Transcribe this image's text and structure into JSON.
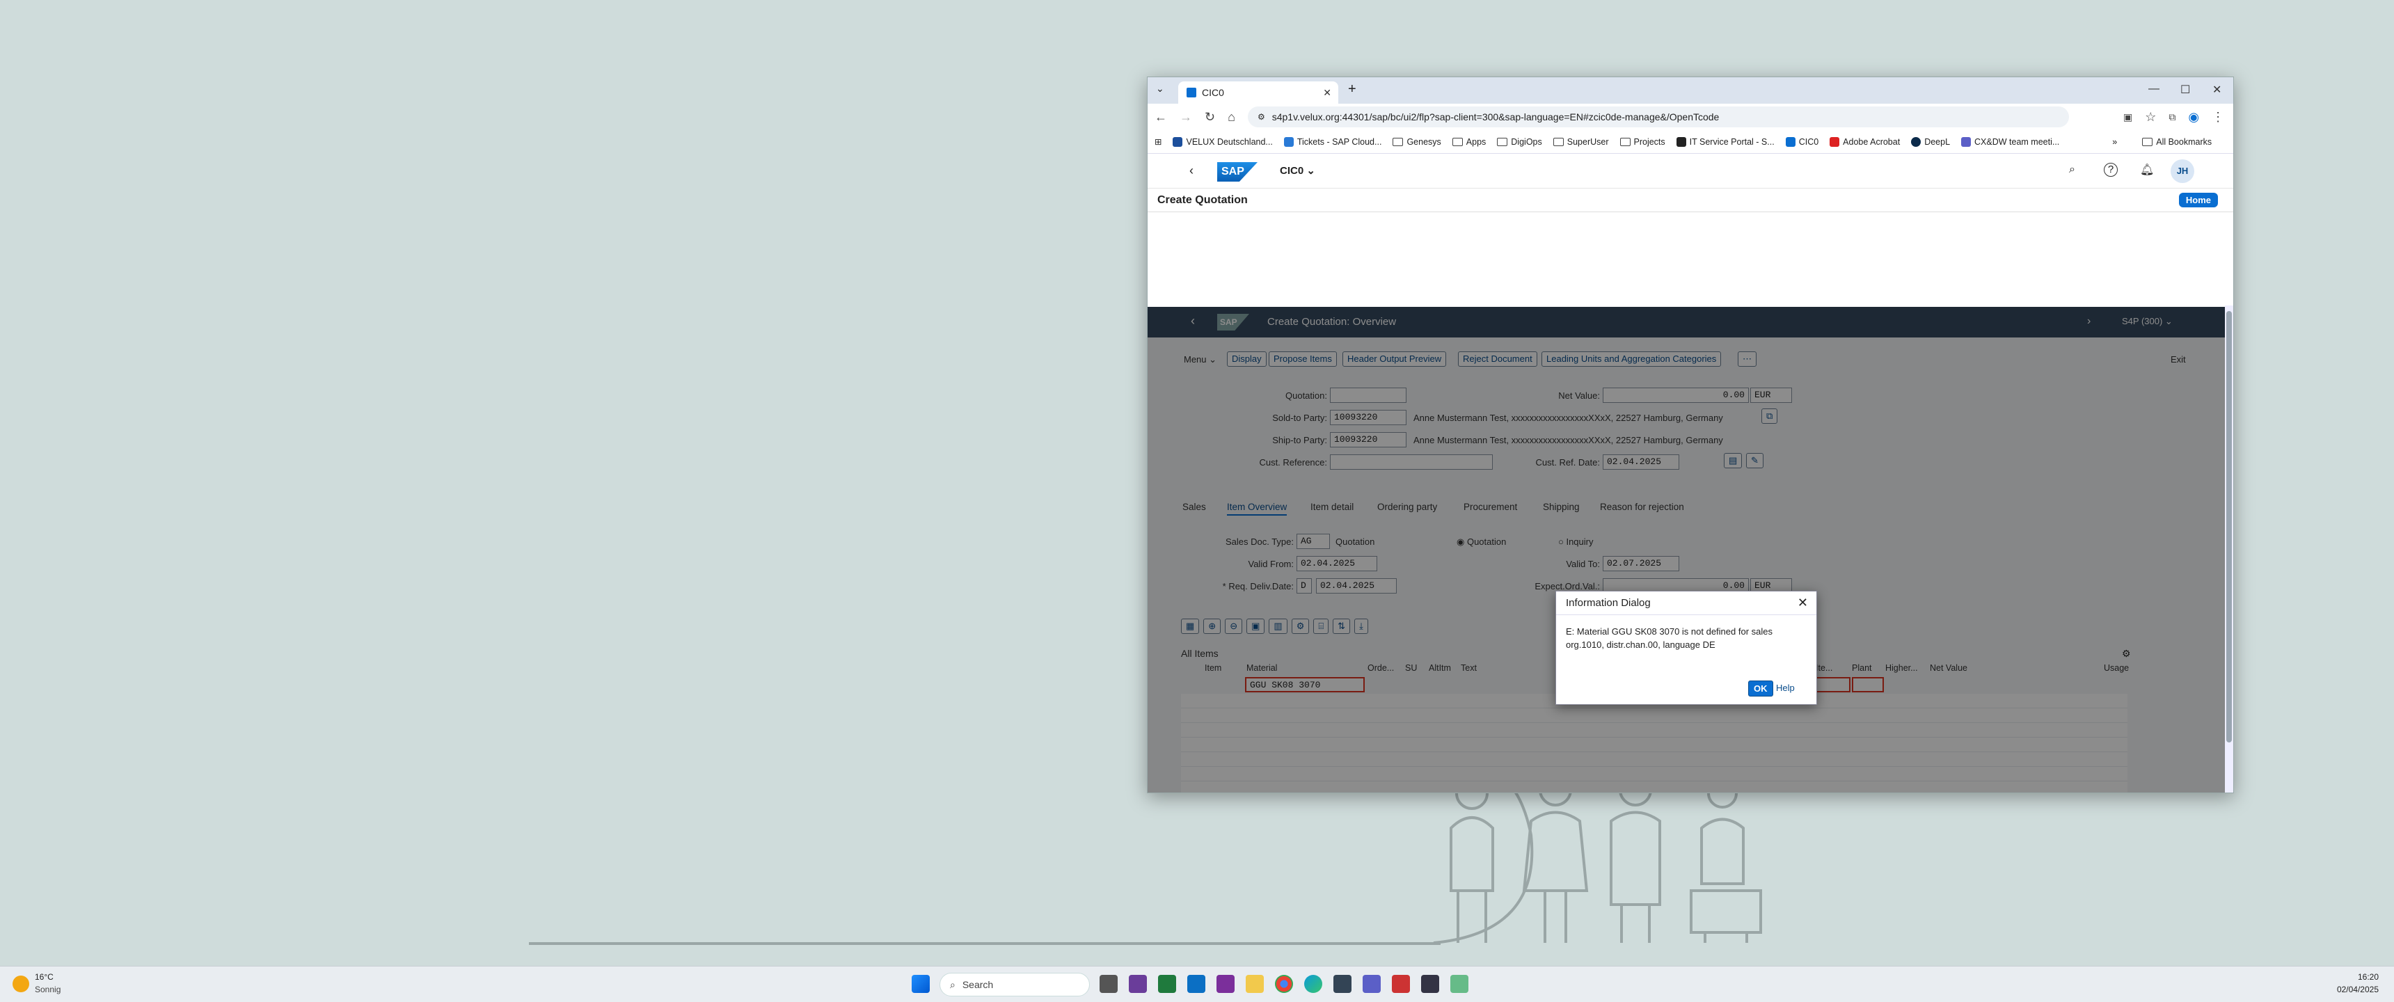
{
  "browser": {
    "tab_title": "CIC0",
    "url": "s4p1v.velux.org:44301/sap/bc/ui2/flp?sap-client=300&sap-language=EN#zcic0de-manage&/OpenTcode",
    "bookmarks": [
      "VELUX Deutschland...",
      "Tickets - SAP Cloud...",
      "Genesys",
      "Apps",
      "DigiOps",
      "SuperUser",
      "Projects",
      "IT Service Portal - S...",
      "CIC0",
      "Adobe Acrobat",
      "DeepL",
      "CX&DW team meeti..."
    ],
    "all_bookmarks": "All Bookmarks"
  },
  "shell": {
    "logo": "SAP",
    "app_title": "CIC0",
    "avatar": "JH",
    "page_title": "Create Quotation",
    "home_label": "Home"
  },
  "gui": {
    "title": "Create Quotation: Overview",
    "system": "S4P (300)",
    "menu": "Menu",
    "exit": "Exit",
    "toolbar": [
      "Display",
      "Propose Items",
      "Header Output Preview",
      "Reject Document",
      "Leading Units and Aggregation Categories"
    ],
    "fields": {
      "quotation_label": "Quotation:",
      "net_value_label": "Net Value:",
      "net_value": "0.00",
      "currency": "EUR",
      "sold_to_label": "Sold-to Party:",
      "sold_to": "10093220",
      "sold_to_text": "Anne Mustermann Test, xxxxxxxxxxxxxxxxxXXxX, 22527 Hamburg, Germany",
      "ship_to_label": "Ship-to Party:",
      "ship_to": "10093220",
      "ship_to_text": "Anne Mustermann Test, xxxxxxxxxxxxxxxxxXXxX, 22527 Hamburg, Germany",
      "cust_ref_label": "Cust. Reference:",
      "cust_ref_date_label": "Cust. Ref. Date:",
      "cust_ref_date": "02.04.2025"
    },
    "tabs": [
      "Sales",
      "Item Overview",
      "Item detail",
      "Ordering party",
      "Procurement",
      "Shipping",
      "Reason for rejection"
    ],
    "item_overview": {
      "doc_type_label": "Sales Doc. Type:",
      "doc_type": "AG",
      "doc_type_text": "Quotation",
      "radio_quotation": "Quotation",
      "radio_inquiry": "Inquiry",
      "valid_from_label": "Valid From:",
      "valid_from": "02.04.2025",
      "valid_to_label": "Valid To:",
      "valid_to": "02.07.2025",
      "req_deliv_label": "Req. Deliv.Date:",
      "req_deliv_type": "D",
      "req_deliv": "02.04.2025",
      "expect_label": "Expect.Ord.Val.:",
      "expect_val": "0.00",
      "expect_cur": "EUR",
      "all_items": "All Items"
    },
    "columns": [
      "Item",
      "Material",
      "Orde...",
      "SU",
      "AltItm",
      "Text",
      "Ite...",
      "Plant",
      "Higher...",
      "Net Value",
      "Usage"
    ],
    "row_material": "GGU SK08 3070"
  },
  "dialog": {
    "title": "Information Dialog",
    "message": "E: Material GGU SK08 3070 is not defined for sales org.1010,  distr.chan.00,  language DE",
    "ok": "OK",
    "help": "Help"
  },
  "taskbar": {
    "weather_temp": "16°C",
    "weather_text": "Sonnig",
    "search": "Search",
    "time": "16:20",
    "date": "02/04/2025"
  }
}
